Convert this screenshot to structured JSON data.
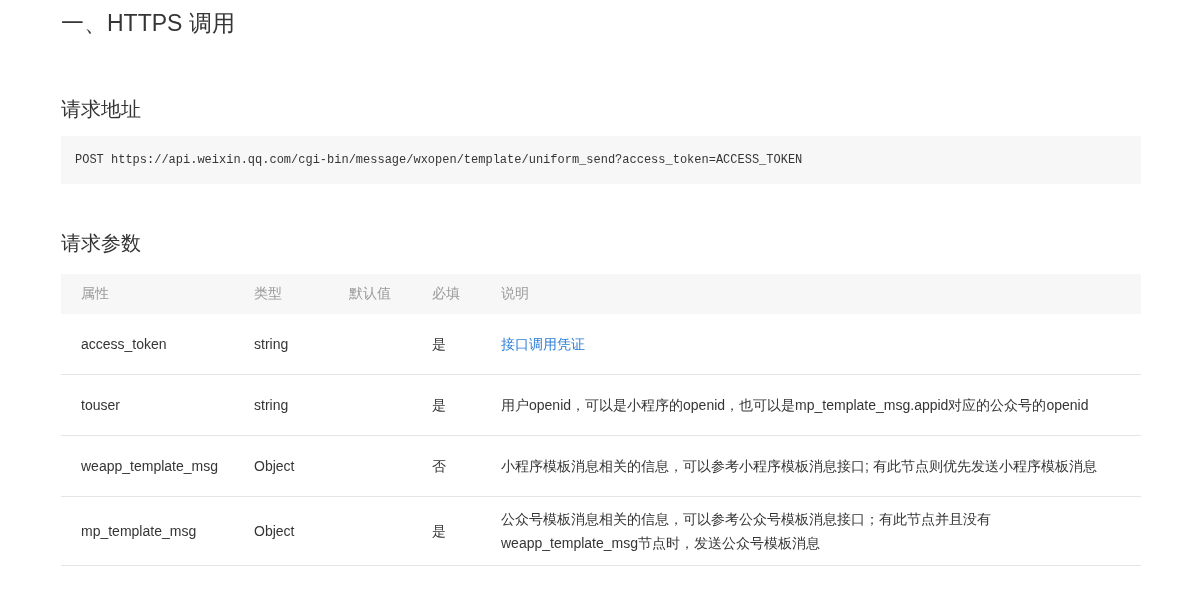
{
  "title": "一、HTTPS 调用",
  "sections": [
    {
      "heading": "请求地址",
      "code": "POST https://api.weixin.qq.com/cgi-bin/message/wxopen/template/uniform_send?access_token=ACCESS_TOKEN"
    },
    {
      "heading": "请求参数",
      "table": {
        "columns": [
          "属性",
          "类型",
          "默认值",
          "必填",
          "说明"
        ],
        "rows": [
          {
            "name": "access_token",
            "type": "string",
            "required": "是",
            "description": {
              "kind": "link",
              "text": "接口调用凭证"
            }
          },
          {
            "name": "touser",
            "type": "string",
            "required": "是",
            "description": {
              "kind": "text",
              "text": "用户openid，可以是小程序的openid，也可以是mp_template_msg.appid对应的公众号的openid"
            }
          },
          {
            "name": "weapp_template_msg",
            "type": "Object",
            "required": "否",
            "description": {
              "kind": "text",
              "text": "小程序模板消息相关的信息，可以参考小程序模板消息接口; 有此节点则优先发送小程序模板消息"
            }
          },
          {
            "name": "mp_template_msg",
            "type": "Object",
            "required": "是",
            "description": {
              "kind": "text",
              "text": "公众号模板消息相关的信息，可以参考公众号模板消息接口；有此节点并且没有weapp_template_msg节点时，发送公众号模板消息"
            }
          }
        ]
      }
    }
  ]
}
